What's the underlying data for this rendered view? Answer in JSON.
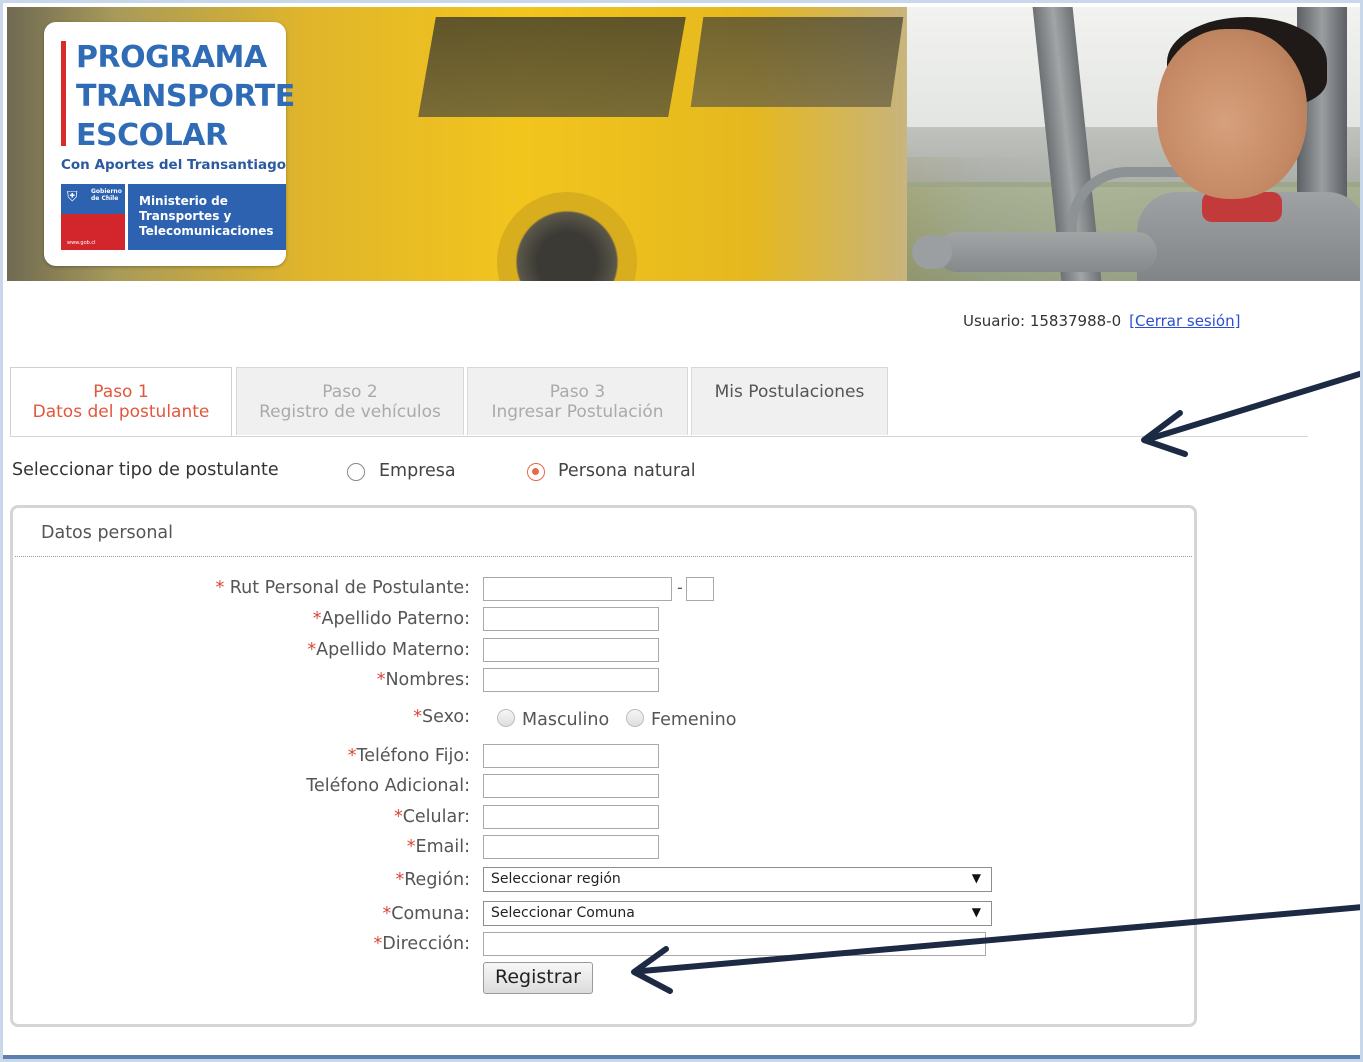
{
  "banner": {
    "logo_lines": [
      "PROGRAMA",
      "TRANSPORTE",
      "ESCOLAR"
    ],
    "logo_subtitle": "Con Aportes del Transantiago",
    "gov_label": "Gobierno de Chile",
    "gov_url": "www.gob.cl",
    "ministry": [
      "Ministerio de",
      "Transportes y",
      "Telecomunicaciones"
    ]
  },
  "session": {
    "user_text": "Usuario: 15837988-0",
    "logout_label": "[Cerrar sesión]"
  },
  "tabs": [
    {
      "line1": "Paso 1",
      "line2": "Datos del postulante"
    },
    {
      "line1": "Paso 2",
      "line2": "Registro de vehículos"
    },
    {
      "line1": "Paso 3",
      "line2": "Ingresar Postulación"
    },
    {
      "line1": "Mis Postulaciones",
      "line2": ""
    }
  ],
  "applicant_type": {
    "label": "Seleccionar tipo de postulante",
    "options": [
      "Empresa",
      "Persona natural"
    ],
    "selected": "Persona natural"
  },
  "panel": {
    "title": "Datos personal",
    "fields": {
      "rut": "Rut Personal de Postulante:",
      "apellido_paterno": "Apellido Paterno:",
      "apellido_materno": "Apellido Materno:",
      "nombres": "Nombres:",
      "sexo": "Sexo:",
      "telefono_fijo": "Teléfono Fijo:",
      "telefono_adicional": "Teléfono Adicional:",
      "celular": "Celular:",
      "email": "Email:",
      "region": "Región:",
      "comuna": "Comuna:",
      "direccion": "Dirección:"
    },
    "required_mark": "*",
    "rut_separator": "-",
    "sex_options": [
      "Masculino",
      "Femenino"
    ],
    "region_select": "Seleccionar región",
    "comuna_select": "Seleccionar Comuna",
    "submit_label": "Registrar"
  },
  "colors": {
    "accent": "#e2563c",
    "link": "#2a4fd0",
    "brand_blue": "#2d62b0",
    "arrow": "#1d2a44"
  }
}
